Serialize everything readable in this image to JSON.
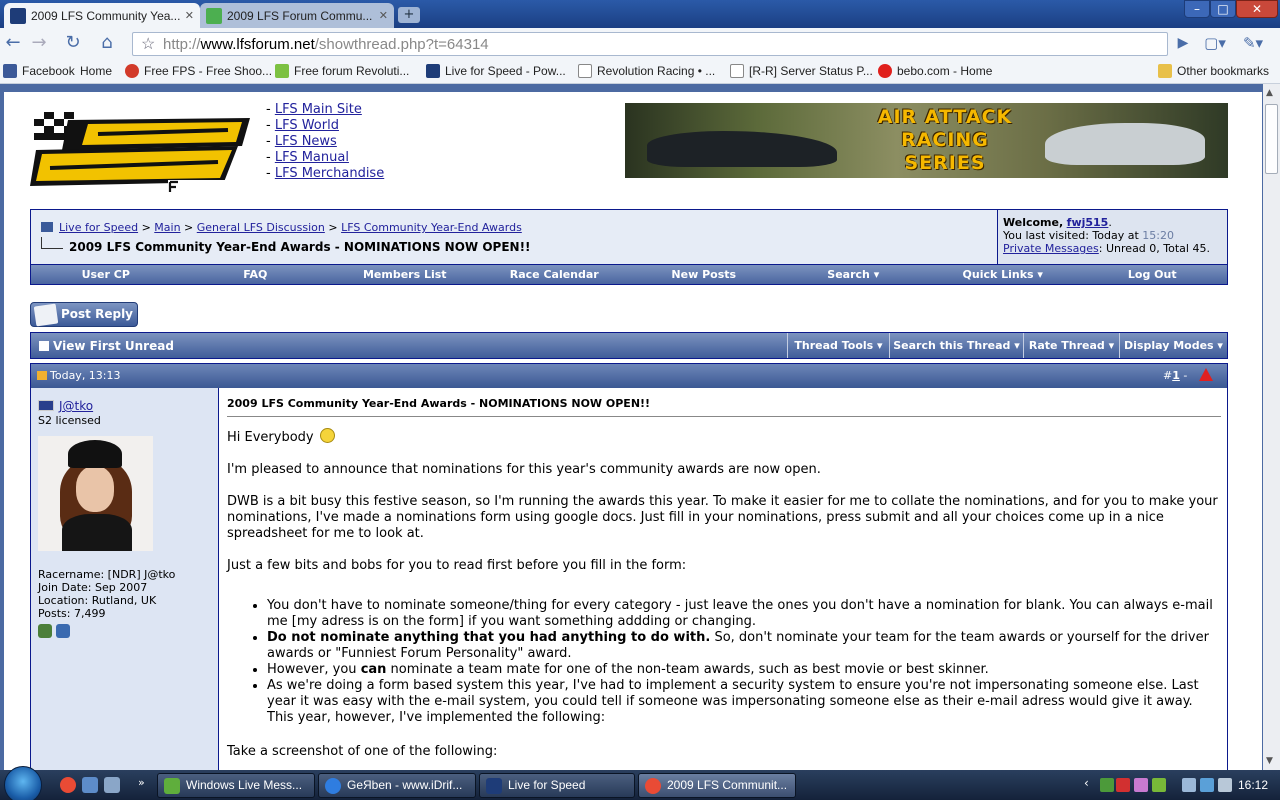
{
  "browser": {
    "tabs": [
      {
        "label": "2009 LFS Community Yea...",
        "active": true
      },
      {
        "label": "2009 LFS Forum Commu...",
        "active": false
      }
    ],
    "newtab_label": "+",
    "url_scheme": "http://",
    "url_host": "www.lfsforum.net",
    "url_path": "/showthread.php?t=64314",
    "bookmarks": [
      "Facebook",
      "Home",
      "Free FPS - Free Shoo...",
      "Free forum  Revoluti...",
      "Live for Speed - Pow...",
      "Revolution Racing • ...",
      "[R-R] Server Status P...",
      "bebo.com - Home"
    ],
    "other_bookmarks": "Other bookmarks"
  },
  "site": {
    "top_links": [
      "LFS Main Site",
      "LFS World",
      "LFS News",
      "LFS Manual",
      "LFS Merchandise"
    ],
    "banner_lines": [
      "AIR ATTACK",
      "RACING",
      "SERIES"
    ]
  },
  "breadcrumb": {
    "items": [
      "Live for Speed",
      "Main",
      "General LFS Discussion",
      "LFS Community Year-End Awards"
    ],
    "separator": ">",
    "thread_title": "2009 LFS Community Year-End Awards - NOMINATIONS NOW OPEN!!"
  },
  "welcome": {
    "label": "Welcome,",
    "username": "fwj515",
    "last_visit_label": "You last visited: Today at",
    "last_visit_time": "15:20",
    "pm_link": "Private Messages",
    "pm_stats": ": Unread 0, Total 45."
  },
  "menu": [
    "User CP",
    "FAQ",
    "Members List",
    "Race Calendar",
    "New Posts",
    "Search ▾",
    "Quick Links ▾",
    "Log Out"
  ],
  "post_reply_label": "Post Reply",
  "thread_tools": {
    "view_first_unread": "View First Unread",
    "buttons": [
      "Thread Tools ▾",
      "Search this Thread ▾",
      "Rate Thread ▾",
      "Display Modes ▾"
    ]
  },
  "post": {
    "date": "Today, 13:13",
    "number_prefix": "#",
    "number": "1",
    "number_suffix": " -",
    "author": "J@tko",
    "author_title": "S2 licensed",
    "stats": [
      "Racername: [NDR] J@tko",
      "Join Date: Sep 2007",
      "Location: Rutland, UK",
      "Posts: 7,499"
    ],
    "title": "2009 LFS Community Year-End Awards - NOMINATIONS NOW OPEN!!",
    "greeting": "Hi Everybody",
    "para1": "I'm pleased to announce that nominations for this year's community awards are now open.",
    "para2": "DWB is a bit busy this festive season, so I'm running the awards this year. To make it easier for me to collate the nominations, and for you to make your nominations, I've made a nominations form using google docs. Just fill in your nominations, press submit and all your choices come up in a nice spreadsheet for me to look at.",
    "para3": "Just a few bits and bobs for you to read first before you fill in the form:",
    "bullet1": "You don't have to nominate someone/thing for every category - just leave the ones you don't have a nomination for blank. You can always e-mail me [my adress is on the form] if you want something addding or changing.",
    "bullet2_bold": "Do not nominate anything that you had anything to do with.",
    "bullet2_rest": " So, don't nominate your team for the team awards or yourself for the driver awards or \"Funniest Forum Personality\" award.",
    "bullet3_a": "However, you ",
    "bullet3_bold": "can",
    "bullet3_b": " nominate a team mate for one of the non-team awards, such as best movie or best skinner.",
    "bullet4": "As we're doing a form based system this year, I've had to implement a security system to ensure you're not impersonating someone else. Last year it was easy with the e-mail system, you could tell if someone was impersonating someone else as their e-mail adress would give it away. This year, however, I've implemented the following:",
    "para4": "Take a screenshot of one of the following:"
  },
  "taskbar": {
    "tasks": [
      "Windows Live Mess...",
      "GeЯben - www.iDrif...",
      "Live for Speed",
      "2009 LFS Communit..."
    ],
    "clock": "16:12"
  },
  "colors": {
    "link": "#22229c",
    "nav_border": "#0b198c",
    "header_bar": "#4a65a0",
    "crumb_bg": "#e6ecf6",
    "user_pane_bg": "#dde5f3"
  }
}
